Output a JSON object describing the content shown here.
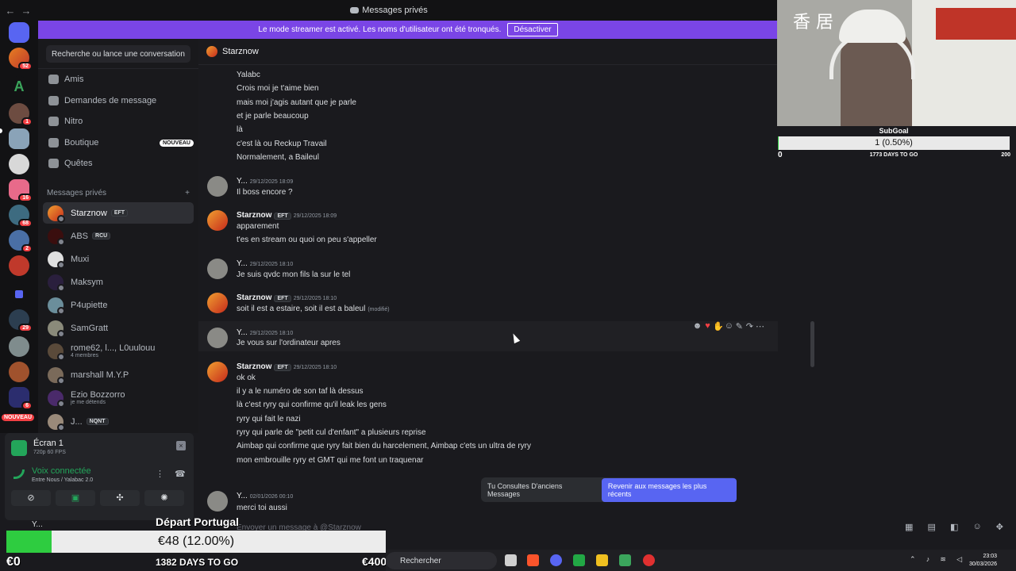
{
  "window": {
    "title": "Messages privés",
    "back": "←",
    "forward": "→"
  },
  "banner": {
    "text": "Le mode streamer est activé. Les noms d'utilisateur ont été tronqués.",
    "button": "Désactiver"
  },
  "rail": {
    "badges": [
      "52",
      "1",
      "16",
      "68",
      "2",
      "29",
      "6",
      "3"
    ],
    "nouveau": "NOUVEAU"
  },
  "sidebar": {
    "search": "Recherche ou lance une conversation",
    "nav": [
      {
        "label": "Amis"
      },
      {
        "label": "Demandes de message"
      },
      {
        "label": "Nitro"
      },
      {
        "label": "Boutique",
        "tag": "NOUVEAU"
      },
      {
        "label": "Quêtes"
      }
    ],
    "dm_header": "Messages privés",
    "dm_add": "+",
    "dms": [
      {
        "name": "Starznow",
        "tag": "EFT"
      },
      {
        "name": "ABS",
        "tag": "RCU"
      },
      {
        "name": "Muxi"
      },
      {
        "name": "Maksym"
      },
      {
        "name": "P4upiette"
      },
      {
        "name": "SamGratt"
      },
      {
        "name": "rome62, l..., L0uulouu",
        "sub": "4 membres"
      },
      {
        "name": "marshall M.Y.P"
      },
      {
        "name": "Ezio Bozzorro",
        "sub": "je me détends"
      },
      {
        "name": "J...",
        "tag": "NQNT"
      }
    ]
  },
  "panel": {
    "screen_title": "Écran 1",
    "screen_sub": "720p 60 FPS",
    "voice_title": "Voix connectée",
    "voice_sub": "Entre Nous / Yalabac 2.0",
    "user": "Y..."
  },
  "chat": {
    "header": "Starznow",
    "messages": [
      {
        "lines": [
          "Yalabc",
          "Crois moi je t'aime bien",
          "mais moi j'agis autant que je parle",
          "et je parle beaucoup",
          "là",
          "c'est là ou Reckup Travail",
          "Normalement, a Baileul"
        ]
      },
      {
        "author": "Y...",
        "time": "29/12/2025 18:09",
        "lines": [
          "Il boss encore ?"
        ]
      },
      {
        "author": "Starznow",
        "tag": "EFT",
        "time": "29/12/2025 18:09",
        "lines": [
          "apparement",
          "t'es en stream ou quoi on peu s'appeller"
        ]
      },
      {
        "author": "Y...",
        "time": "29/12/2025 18:10",
        "lines": [
          "Je suis qvdc mon fils la sur le tel"
        ]
      },
      {
        "author": "Starznow",
        "tag": "EFT",
        "time": "29/12/2025 18:10",
        "lines": [
          "soit il est a estaire, soit il est a baleul"
        ],
        "edited": "(modifié)"
      },
      {
        "author": "Y...",
        "time": "29/12/2025 18:10",
        "lines": [
          "Je vous sur l'ordinateur apres"
        ]
      },
      {
        "author": "Starznow",
        "tag": "EFT",
        "time": "29/12/2025 18:10",
        "lines": [
          "ok ok",
          "il y a le numéro de son taf là dessus",
          "là c'est ryry qui confirme qu'il leak les gens",
          "ryry qui fait le nazi",
          "ryry qui parle de \"petit cul d'enfant\" a plusieurs reprise",
          "Aimbap qui confirme que ryry fait bien du harcelement, Aimbap c'ets un ultra de ryry",
          "mon embrouille ryry et GMT qui me font un traquenar"
        ]
      },
      {
        "author": "Y...",
        "time": "02/01/2026 00:10",
        "lines": [
          "merci toi aussi"
        ]
      }
    ],
    "jump_text": "Tu Consultes D'anciens Messages",
    "jump_button": "Revenir aux messages les plus récents",
    "composer_placeholder": "Envoyer un message à @Starznow"
  },
  "subgoal": {
    "title": "SubGoal",
    "bar_text": "1 (0.50%)",
    "progress": 0.005,
    "min": "0",
    "days": "1773 DAYS TO GO",
    "max": "200"
  },
  "donation": {
    "title": "Départ Portugal",
    "bar_text": "€48 (12.00%)",
    "progress": 0.12,
    "min": "€0",
    "days": "1382 DAYS TO GO",
    "max": "€400"
  },
  "taskbar": {
    "search": "Rechercher",
    "time": "23:03",
    "date": "30/03/2026"
  },
  "colors": {
    "accent": "#5865f2",
    "banner": "#7a45e6",
    "online": "#23a55a",
    "goal_fill": "#2ecc40",
    "alert": "#f23f43"
  }
}
